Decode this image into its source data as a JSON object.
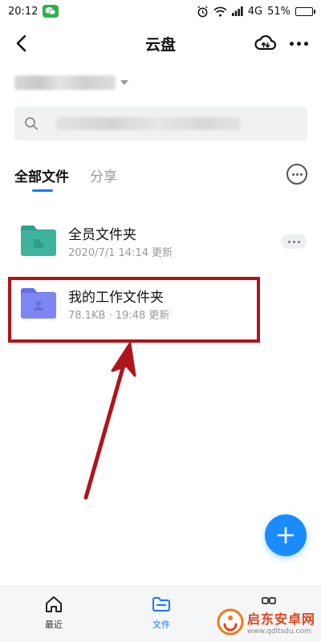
{
  "status_bar": {
    "time": "20:12",
    "network": "4G",
    "battery": "51%",
    "battery_level_percent": 51
  },
  "header": {
    "title": "云盘"
  },
  "tabs": {
    "active": "全部文件",
    "inactive": "分享"
  },
  "files": [
    {
      "name": "全员文件夹",
      "meta": "2020/7/1 14:14 更新",
      "icon_color": "#3db39e"
    },
    {
      "name": "我的工作文件夹",
      "meta": "78.1KB · 19:48 更新",
      "icon_color": "#7d86f5"
    }
  ],
  "bottom_nav": {
    "items": [
      {
        "label": "最近"
      },
      {
        "label": "文件"
      }
    ]
  },
  "watermark": {
    "title": "启东安卓网",
    "url": "www.qdltsdu.com"
  },
  "colors": {
    "accent": "#1677ff",
    "fab": "#1a8cff",
    "highlight": "#b0141c"
  }
}
